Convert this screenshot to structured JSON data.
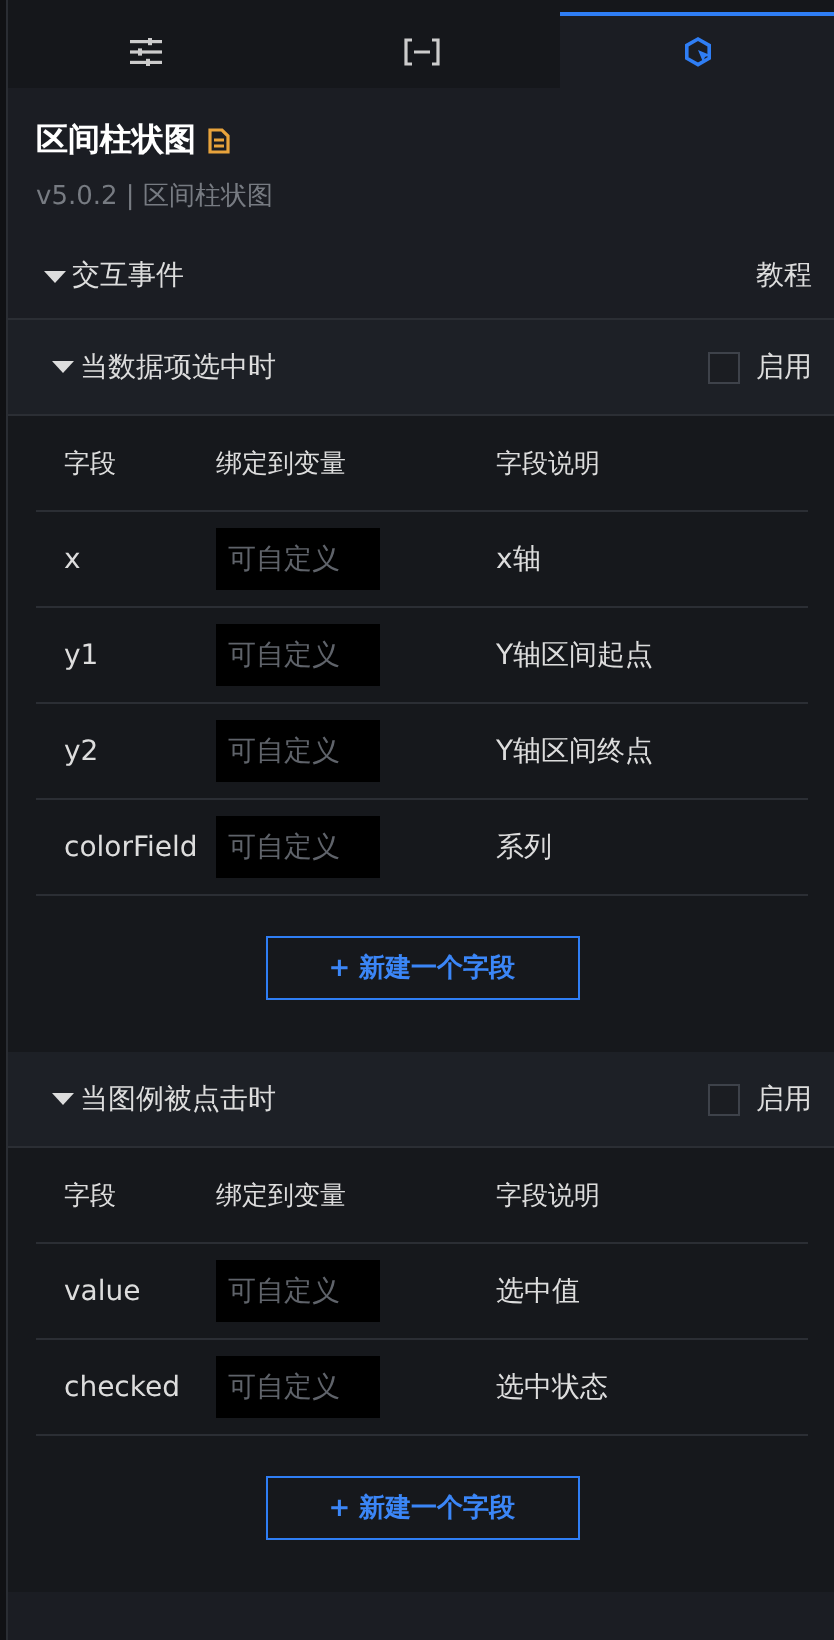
{
  "tabs": [
    {
      "kind": "sliders",
      "selected": false
    },
    {
      "kind": "bracket",
      "selected": false
    },
    {
      "kind": "interaction",
      "selected": true
    }
  ],
  "header": {
    "title": "区间柱状图",
    "version": "v5.0.2 | 区间柱状图"
  },
  "interaction": {
    "title": "交互事件",
    "expanded": true,
    "help_link": "教程",
    "events": [
      {
        "title": "当数据项选中时",
        "expanded": true,
        "enabled": false,
        "enable_label": "启用",
        "columns": [
          "字段",
          "绑定到变量",
          "字段说明"
        ],
        "rows": [
          {
            "field": "x",
            "placeholder": "可自定义",
            "description": "x轴"
          },
          {
            "field": "y1",
            "placeholder": "可自定义",
            "description": "Y轴区间起点"
          },
          {
            "field": "y2",
            "placeholder": "可自定义",
            "description": "Y轴区间终点"
          },
          {
            "field": "colorField",
            "placeholder": "可自定义",
            "description": "系列"
          }
        ],
        "add_button": "+ 新建一个字段"
      },
      {
        "title": "当图例被点击时",
        "expanded": true,
        "enabled": false,
        "enable_label": "启用",
        "columns": [
          "字段",
          "绑定到变量",
          "字段说明"
        ],
        "rows": [
          {
            "field": "value",
            "placeholder": "可自定义",
            "description": "选中值"
          },
          {
            "field": "checked",
            "placeholder": "可自定义",
            "description": "选中状态"
          }
        ],
        "add_button": "+ 新建一个字段"
      }
    ]
  }
}
